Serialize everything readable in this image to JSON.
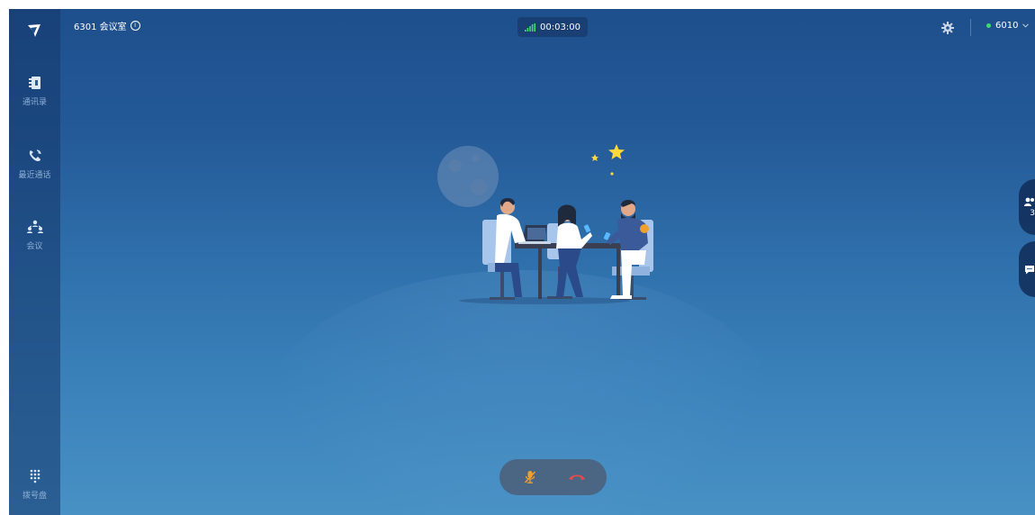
{
  "header": {
    "room_title": "6301 会议室",
    "timer": "00:03:00",
    "account_label": "6010"
  },
  "sidebar": {
    "items": [
      {
        "label": "通讯录",
        "icon": "contacts-icon"
      },
      {
        "label": "最近通话",
        "icon": "recent-calls-icon"
      },
      {
        "label": "会议",
        "icon": "meeting-icon"
      },
      {
        "label": "拨号盘",
        "icon": "dialpad-icon"
      }
    ]
  },
  "right_panel": {
    "participants_count": "3"
  },
  "controls": {
    "mute_icon": "mic-muted-icon",
    "hangup_icon": "hangup-icon"
  },
  "colors": {
    "background_top": "#1e4f8d",
    "background_bottom": "#4791c5",
    "signal_green": "#3ddc6e",
    "hangup_red": "#e84a4a",
    "mute_orange": "#f0a030"
  }
}
